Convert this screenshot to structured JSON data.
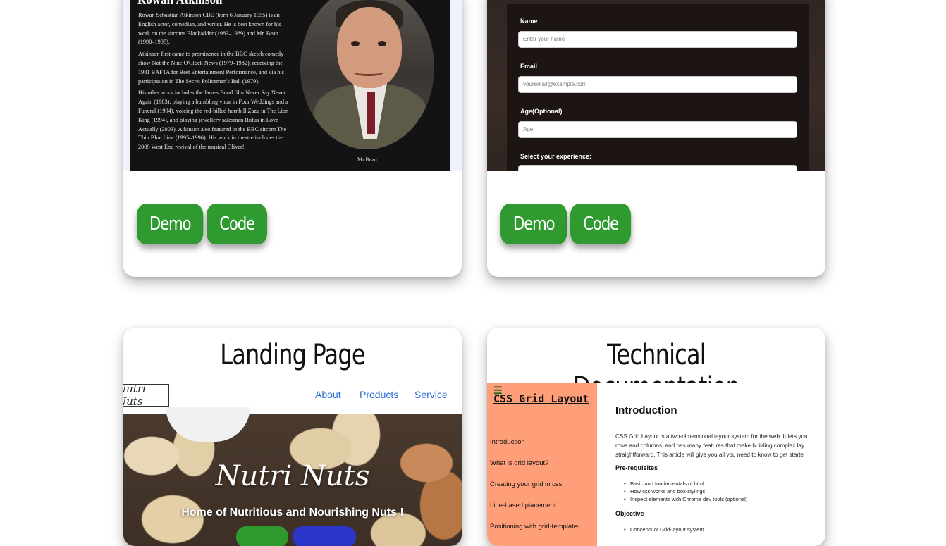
{
  "card1": {
    "tribute": {
      "title": "Rowan Atkinson",
      "paragraphs": [
        "Rowan Sebastian Atkinson CBE (born 6 January 1955) is an English actor, comedian, and writer. He is best known for his work on the sitcoms Blackadder (1983–1989) and Mr. Bean (1990–1995).",
        "Atkinson first came to prominence in the BBC sketch comedy show Not the Nine O'Clock News (1979–1982), receiving the 1981 BAFTA for Best Entertainment Performance, and via his participation in The Secret Policeman's Ball (1979).",
        "His other work includes the James Bond film Never Say Never Again (1983), playing a bumbling vicar in Four Weddings and a Funeral (1994), voicing the red-billed hornbill Zazu in The Lion King (1994), and playing jewellery salesman Rufus in Love Actually (2003). Atkinson also featured in the BBC sitcom The Thin Blue Line (1995–1996). His work in theatre includes the 2009 West End revival of the musical Oliver!."
      ],
      "caption": "Mr.Bean"
    },
    "demo_label": "Demo",
    "code_label": "Code"
  },
  "card2": {
    "survey": {
      "name_label": "Name",
      "name_placeholder": "Enter  your  name",
      "email_label": "Email",
      "email_placeholder": "youremail@example.com",
      "age_label": "Age(Optional)",
      "age_placeholder": "Age",
      "experience_label": "Select  your  experience:"
    },
    "demo_label": "Demo",
    "code_label": "Code"
  },
  "card3": {
    "title": "Landing Page",
    "landing": {
      "logo": "Nutri Nuts",
      "nav": [
        "About",
        "Products",
        "Service"
      ],
      "brand": "Nutri Nuts",
      "tagline": "Home of Nutritious and Nourishing Nuts !"
    }
  },
  "card4": {
    "title": "Technical Documentation",
    "doc": {
      "menu_icon": "☰",
      "side_title": "CSS Grid Layout",
      "nav_links": [
        "Introduction",
        "What is grid layout?",
        "Creating your grid in css",
        "Line-based placement",
        "Positioning with grid-template-"
      ],
      "heading": "Introduction",
      "intro_lines": [
        "CSS Grid Layout is a two-dimensional layout system for the web. It lets you",
        "rows and columns, and has many features that make building complex lay",
        "straightforward. This article will give you all you need to know to get starte"
      ],
      "prereq_heading": "Pre-requisites",
      "prereq_items": [
        "Basic and fundamentals of html",
        "How css works and box-stylings",
        "Inspect elements with Chrome dev tools (optional)"
      ],
      "objective_heading": "Objective",
      "objective_items": [
        "Concepts of Grid-layout system"
      ]
    }
  },
  "colors": {
    "button_green": "#2f9a2f",
    "link_blue": "#2b6fd6",
    "doc_sidebar": "#ff9f7a"
  }
}
